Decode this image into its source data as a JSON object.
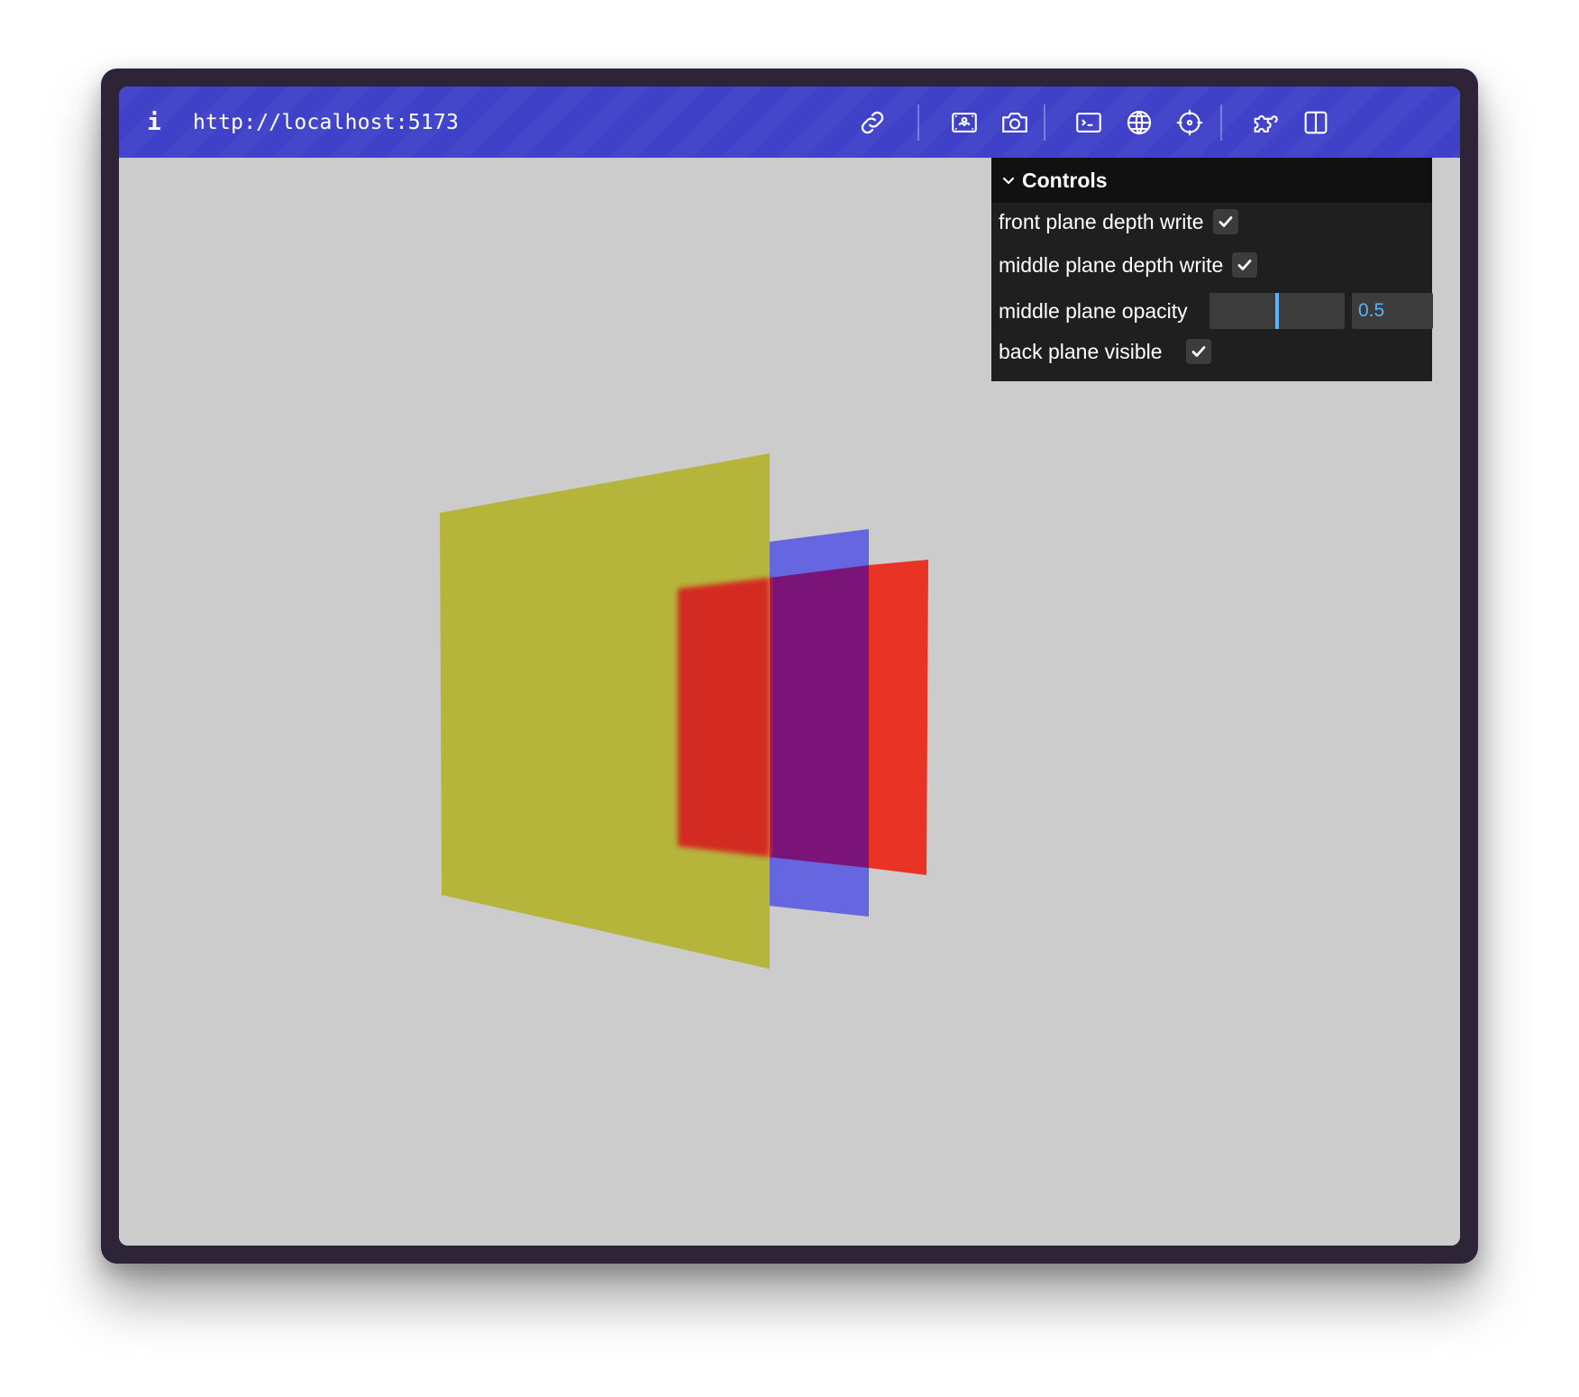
{
  "browser": {
    "url": "http://localhost:5173",
    "toolbar_icons": [
      "info-icon",
      "link-icon",
      "image-icon",
      "camera-icon",
      "terminal-icon",
      "globe-icon",
      "crosshair-icon",
      "puzzle-icon",
      "split-view-icon"
    ],
    "accent_color": "#3f41c8"
  },
  "controls": {
    "title": "Controls",
    "front_depth_write": {
      "label": "front plane depth write",
      "checked": true
    },
    "middle_depth_write": {
      "label": "middle plane depth write",
      "checked": true
    },
    "middle_opacity": {
      "label": "middle plane opacity",
      "value": "0.5",
      "min": 0,
      "max": 1
    },
    "back_visible": {
      "label": "back plane visible",
      "checked": true
    }
  },
  "scene": {
    "background": "#cccccc",
    "front_plane_color": "#b5b53b",
    "middle_plane_color": "#6666e0",
    "back_plane_color": "#e93324",
    "overlap_red_color": "#d32c20",
    "overlap_purple_color": "#7a1479"
  }
}
